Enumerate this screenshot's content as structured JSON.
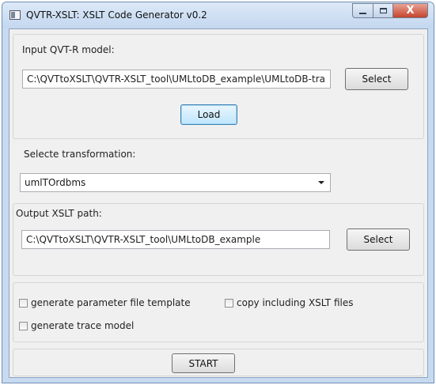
{
  "window": {
    "title": "QVTR-XSLT: XSLT Code Generator v0.2",
    "close_glyph": "X"
  },
  "input_model": {
    "label": "Input QVT-R model:",
    "path": "C:\\QVTtoXSLT\\QVTR-XSLT_tool\\UMLtoDB_example\\UMLtoDB-tra",
    "select_label": "Select",
    "load_label": "Load"
  },
  "transformation": {
    "label": "Selecte transformation:",
    "selected": "umlTOrdbms"
  },
  "output": {
    "label": "Output XSLT path:",
    "path": "C:\\QVTtoXSLT\\QVTR-XSLT_tool\\UMLtoDB_example",
    "select_label": "Select"
  },
  "options": {
    "param_template": "generate parameter file template",
    "copy_xslt": "copy including XSLT files",
    "trace_model": "generate trace model"
  },
  "start_label": "START",
  "colors": {
    "title_gradient_top": "#dce9f8",
    "close_button": "#c4442c",
    "focus_button": "#bee6fd"
  }
}
